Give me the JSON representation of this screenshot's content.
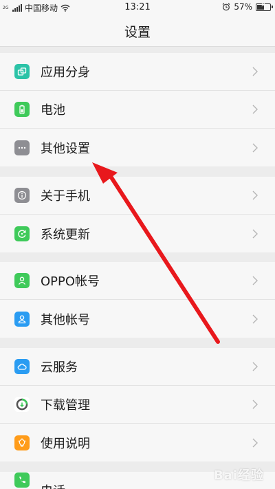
{
  "status_bar": {
    "network": "2G",
    "carrier": "中国移动",
    "time": "13:21",
    "battery_percent": "57%",
    "battery_level": 0.57
  },
  "header": {
    "title": "设置"
  },
  "groups": [
    {
      "items": [
        {
          "label": "应用分身",
          "icon": "app-clone-icon",
          "color": "#2cc3a7"
        },
        {
          "label": "电池",
          "icon": "battery-icon",
          "color": "#3fca5a"
        },
        {
          "label": "其他设置",
          "icon": "more-dots-icon",
          "color": "#8e8e93"
        }
      ]
    },
    {
      "items": [
        {
          "label": "关于手机",
          "icon": "info-icon",
          "color": "#8e8e93"
        },
        {
          "label": "系统更新",
          "icon": "update-icon",
          "color": "#3fca5a"
        }
      ]
    },
    {
      "items": [
        {
          "label": "OPPO帐号",
          "icon": "oppo-account-icon",
          "color": "#3fca5a"
        },
        {
          "label": "其他帐号",
          "icon": "other-account-icon",
          "color": "#2a9cf2"
        }
      ]
    },
    {
      "items": [
        {
          "label": "云服务",
          "icon": "cloud-icon",
          "color": "#2a9cf2"
        },
        {
          "label": "下载管理",
          "icon": "download-manager-icon",
          "color": "#ffffff"
        },
        {
          "label": "使用说明",
          "icon": "bulb-icon",
          "color": "#ff9c1a"
        }
      ]
    },
    {
      "items": [
        {
          "label": "电话",
          "icon": "phone-icon",
          "color": "#3fca5a"
        }
      ]
    }
  ],
  "annotation": {
    "color": "#e8181c"
  },
  "watermark": {
    "text": "Bai经验"
  }
}
